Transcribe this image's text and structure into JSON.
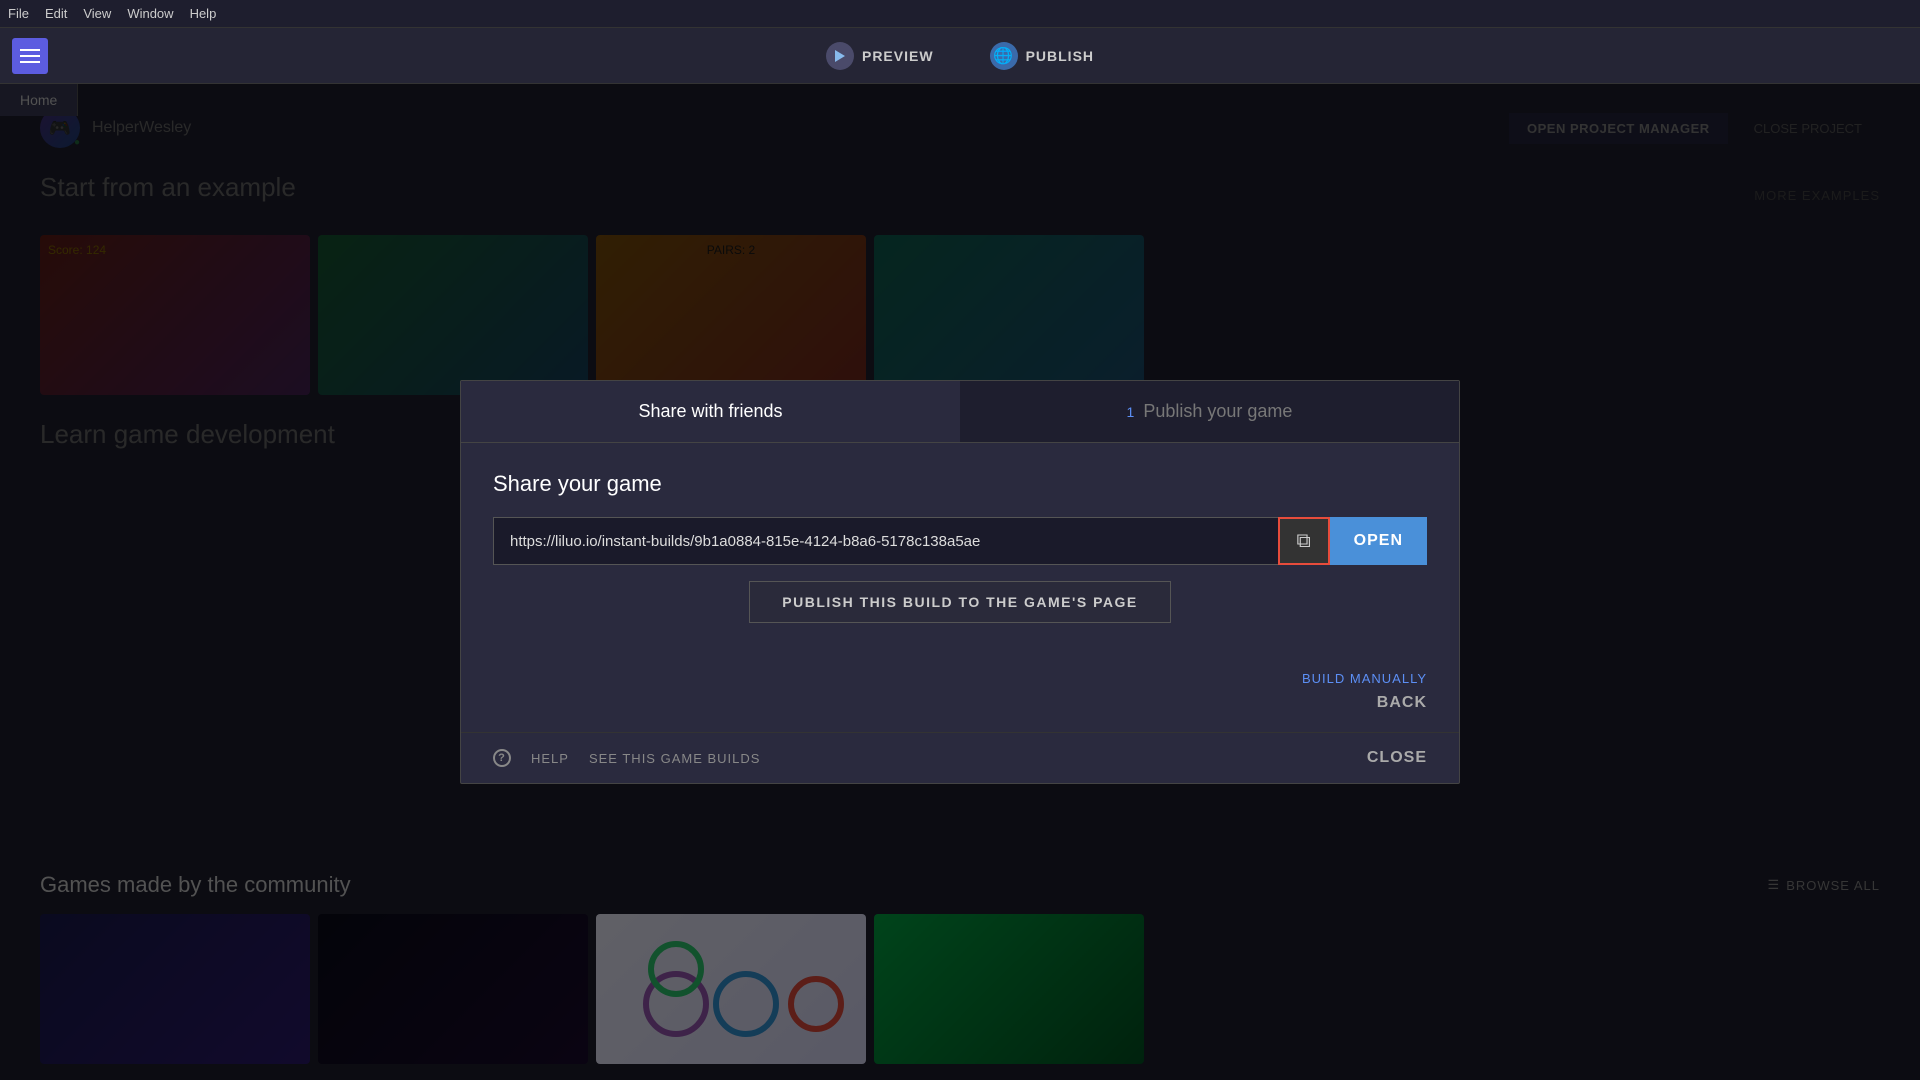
{
  "menubar": {
    "items": [
      "File",
      "Edit",
      "View",
      "Window",
      "Help"
    ]
  },
  "toolbar": {
    "preview_label": "PREVIEW",
    "publish_label": "PUBLISH"
  },
  "home_tab": {
    "label": "Home"
  },
  "project": {
    "name": "HelperWesley",
    "open_manager_label": "OPEN PROJECT MANAGER",
    "close_project_label": "CLOSE PROJECT"
  },
  "examples_section": {
    "title": "Start from an example",
    "more_label": "MORE EXAMPLES"
  },
  "modal": {
    "tab_share": "Share with friends",
    "tab_publish_number": "1",
    "tab_publish": "Publish your game",
    "section_title": "Share your game",
    "url": "https://liluo.io/instant-builds/9b1a0884-815e-4124-b8a6-5178c138a5ae",
    "open_btn": "OPEN",
    "publish_build_btn": "PUBLISH THIS BUILD TO THE GAME'S PAGE",
    "back_btn": "BACK",
    "build_manually": "BUILD MANUALLY",
    "help_label": "HELP",
    "see_builds_label": "SEE THIS GAME BUILDS",
    "close_btn": "CLOSE"
  },
  "games_section": {
    "title": "Games made by the community",
    "browse_all": "BROWSE ALL"
  },
  "learn_section": {
    "title": "Learn game development"
  }
}
